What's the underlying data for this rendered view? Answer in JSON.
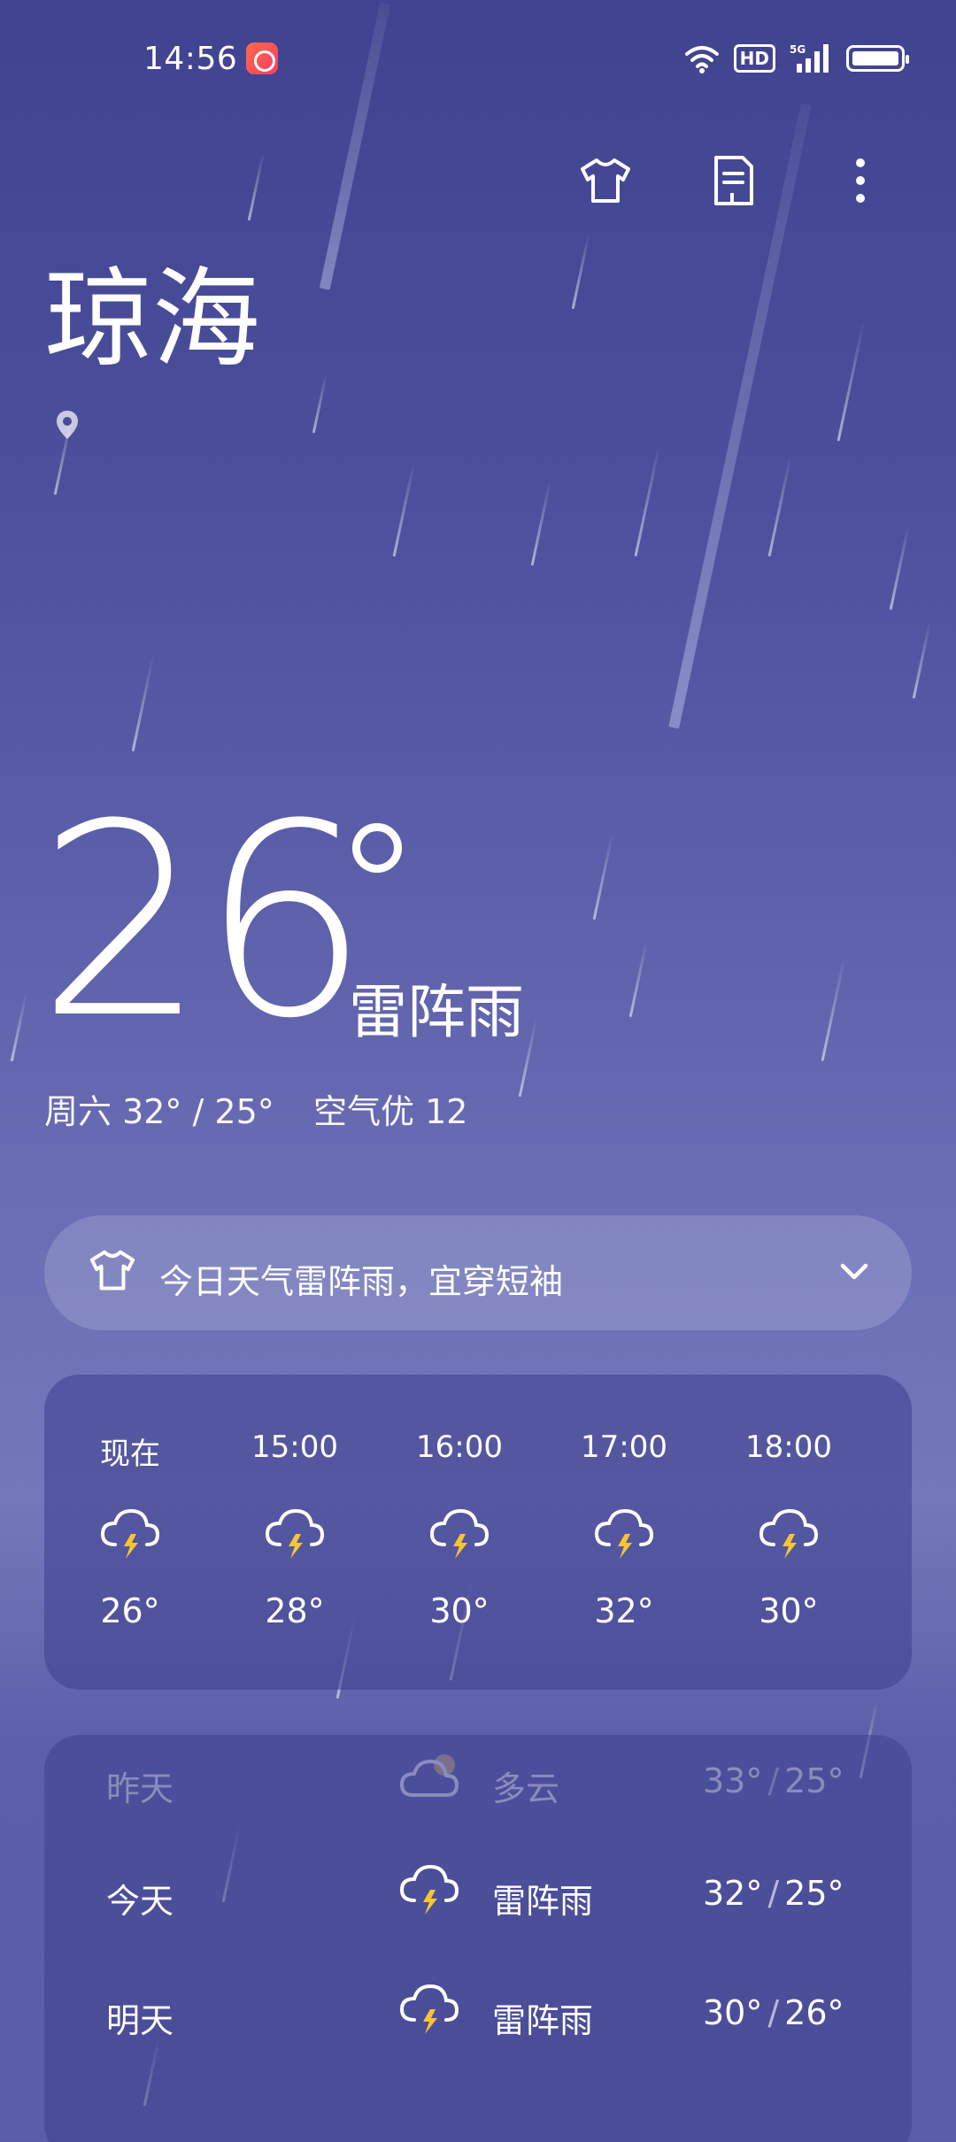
{
  "status_bar": {
    "time": "14:56",
    "app_badge_icon": "video-app-icon",
    "icons": [
      "wifi-icon",
      "hd-icon",
      "5g-signal-icon",
      "battery-icon"
    ],
    "hd_label": "HD",
    "network_label": "5G"
  },
  "toolbar": {
    "items": [
      "shirt-icon",
      "document-icon",
      "more-vertical-icon"
    ]
  },
  "city": {
    "name": "琼海",
    "location_icon": "location-pin-icon"
  },
  "current": {
    "temperature": "26",
    "condition": "雷阵雨",
    "day_range": "周六 32° / 25°",
    "air_quality": "空气优 12"
  },
  "tip": {
    "icon": "shirt-icon",
    "text": "今日天气雷阵雨，宜穿短袖",
    "expand_icon": "chevron-down-icon"
  },
  "hourly": [
    {
      "label": "现在",
      "icon": "thunderstorm-icon",
      "temp": "26°"
    },
    {
      "label": "15:00",
      "icon": "thunderstorm-icon",
      "temp": "28°"
    },
    {
      "label": "16:00",
      "icon": "thunderstorm-icon",
      "temp": "30°"
    },
    {
      "label": "17:00",
      "icon": "thunderstorm-icon",
      "temp": "32°"
    },
    {
      "label": "18:00",
      "icon": "thunderstorm-icon",
      "temp": "30°"
    }
  ],
  "daily": [
    {
      "day": "昨天",
      "icon": "partly-cloudy-icon",
      "condition": "多云",
      "high": "33°",
      "low": "25°",
      "past": true
    },
    {
      "day": "今天",
      "icon": "thunderstorm-icon",
      "condition": "雷阵雨",
      "high": "32°",
      "low": "25°",
      "past": false
    },
    {
      "day": "明天",
      "icon": "thunderstorm-icon",
      "condition": "雷阵雨",
      "high": "30°",
      "low": "26°",
      "past": false
    }
  ],
  "colors": {
    "bolt": "#f7c531",
    "accent_badge": "#f23e65"
  }
}
